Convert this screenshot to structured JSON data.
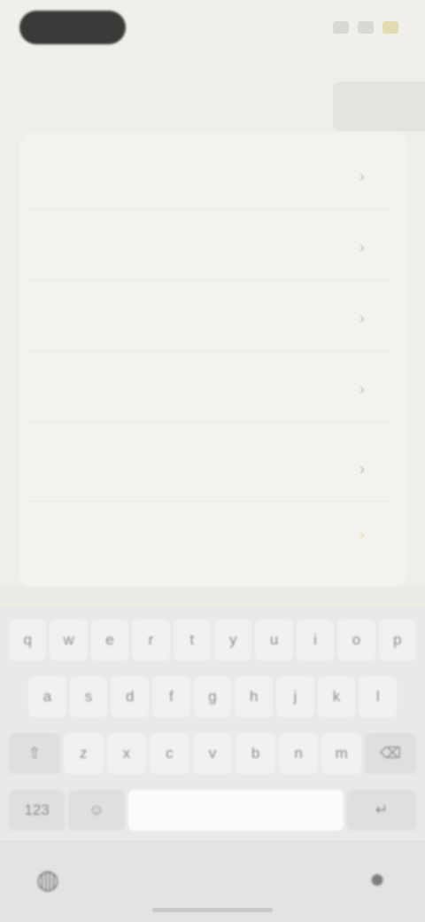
{
  "status_bar": {
    "time": ""
  },
  "sheet": {
    "rows": [
      {
        "label": "",
        "chevron": "chevron-right-icon"
      },
      {
        "label": "",
        "chevron": "chevron-right-icon"
      },
      {
        "label": "",
        "chevron": "chevron-right-icon"
      },
      {
        "label": "",
        "chevron": "chevron-right-icon"
      },
      {
        "label": "",
        "chevron": "chevron-right-icon"
      },
      {
        "label": "",
        "chevron": "chevron-right-icon"
      }
    ]
  },
  "keyboard": {
    "row1": [
      "q",
      "w",
      "e",
      "r",
      "t",
      "y",
      "u",
      "i",
      "o",
      "p"
    ],
    "row2": [
      "a",
      "s",
      "d",
      "f",
      "g",
      "h",
      "j",
      "k",
      "l"
    ],
    "row3": [
      "⇧",
      "z",
      "x",
      "c",
      "v",
      "b",
      "n",
      "m",
      "⌫"
    ],
    "row4": {
      "numbers": "123",
      "emoji": "☺",
      "space": "",
      "return": "↵"
    },
    "bottom": {
      "left_icon": "globe-icon",
      "right_icon": "microphone-icon"
    }
  },
  "colors": {
    "background": "#efeee9",
    "sheet": "#f3f2ec",
    "keyboard": "#e9e9e9",
    "accent_warm": "#e2dcb3"
  }
}
